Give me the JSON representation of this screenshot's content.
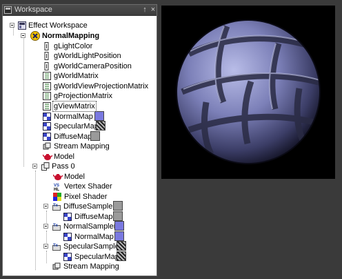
{
  "window": {
    "title": "Workspace",
    "pin_glyph": "↑",
    "close_glyph": "×"
  },
  "tree": {
    "root": "Effect Workspace",
    "effect": "NormalMapping",
    "params": [
      "gLightColor",
      "gWorldLightPosition",
      "gWorldCameraPosition",
      "gWorldMatrix",
      "gWorldViewProjectionMatrix",
      "gProjectionMatrix",
      "gViewMatrix"
    ],
    "textures": [
      "NormalMap",
      "SpecularMap",
      "DiffuseMap"
    ],
    "stream_mapping": "Stream Mapping",
    "model": "Model",
    "pass": {
      "label": "Pass 0",
      "model": "Model",
      "vertex_shader": "Vertex Shader",
      "pixel_shader": "Pixel Shader",
      "samplers": [
        {
          "label": "DiffuseSampler",
          "texture": "DiffuseMap"
        },
        {
          "label": "NormalSampler",
          "texture": "NormalMap"
        },
        {
          "label": "SpecularSampler",
          "texture": "SpecularMap"
        }
      ],
      "stream_mapping": "Stream Mapping"
    }
  },
  "colors": {
    "normal_map": "#7a79e0",
    "specular_map": "#8a8a8a",
    "diffuse_map": "#9a9a9a",
    "sphere_tint": "#8a8fc8",
    "viewport_bg": "#000000"
  }
}
